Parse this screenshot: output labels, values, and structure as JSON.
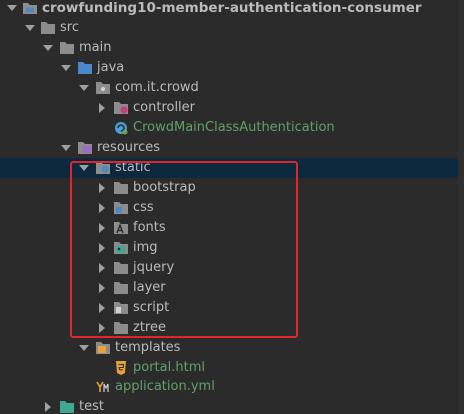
{
  "tree": {
    "root": {
      "label": "crowfunding10-member-authentication-consumer"
    },
    "src": {
      "label": "src"
    },
    "main": {
      "label": "main"
    },
    "java": {
      "label": "java"
    },
    "package": {
      "label": "com.it.crowd"
    },
    "controller": {
      "label": "controller"
    },
    "main_class": {
      "label": "CrowdMainClassAuthentication"
    },
    "resources": {
      "label": "resources"
    },
    "static": {
      "label": "static"
    },
    "static_children": [
      {
        "label": "bootstrap"
      },
      {
        "label": "css"
      },
      {
        "label": "fonts"
      },
      {
        "label": "img"
      },
      {
        "label": "jquery"
      },
      {
        "label": "layer"
      },
      {
        "label": "script"
      },
      {
        "label": "ztree"
      }
    ],
    "templates": {
      "label": "templates"
    },
    "portal": {
      "label": "portal.html"
    },
    "application": {
      "label": "application.yml"
    },
    "test": {
      "label": "test"
    }
  },
  "colors": {
    "background": "#2b2b2b",
    "selection": "#0d293e",
    "highlight_border": "#e0262b",
    "text": "#bbbbbb",
    "green_text": "#62a065"
  }
}
